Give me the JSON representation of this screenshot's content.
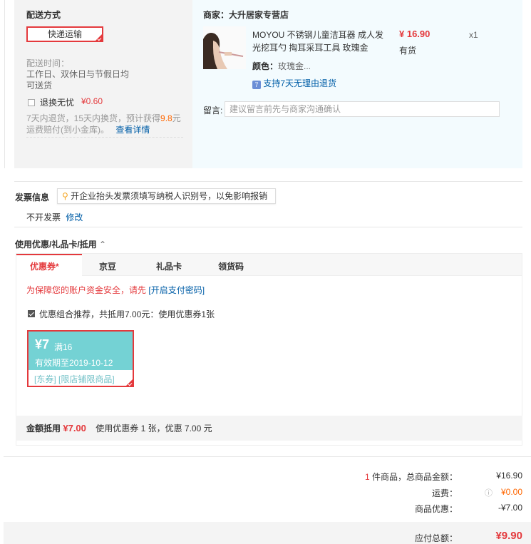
{
  "shipping": {
    "title": "配送方式",
    "method_label": "快递运输",
    "time_label": "配送时间：",
    "time_line1": "工作日、双休日与节假日均",
    "time_line2": "可送货",
    "return_label": "退换无忧",
    "return_price": "¥0.60",
    "return_desc1_a": "7天内退货，15天内换货，预计获得",
    "return_desc1_b": "9.8",
    "return_desc1_c": "元",
    "return_desc2": "运费赔付(到小金库)。",
    "return_detail_link": "查看详情"
  },
  "store": {
    "merchant_label": "商家：大升居家专营店",
    "product_name_line1": "MOYOU 不锈钢儿童洁耳器 成人发",
    "product_name_line2": "光挖耳勺 掏耳采耳工具 玫瑰金",
    "price": "¥ 16.90",
    "stock": "有货",
    "quantity": "x1",
    "color_label": "颜色：",
    "color_value": "玫瑰金...",
    "return_support": "支持7天无理由退货",
    "return_icon_text": "7",
    "message_label": "留言:",
    "message_placeholder": "建议留言前先与商家沟通确认"
  },
  "invoice": {
    "title": "发票信息",
    "tip": "开企业抬头发票须填写纳税人识别号，以免影响报销",
    "status": "不开发票",
    "edit_link": "修改"
  },
  "coupon": {
    "section_title": "使用优惠/礼品卡/抵用",
    "tabs": [
      "优惠券",
      "京豆",
      "礼品卡",
      "领货码"
    ],
    "tab_active_mark": "*",
    "security_warning": "为保障您的账户资金安全，请先",
    "security_link": "[开启支付密码]",
    "recommend_text": "优惠组合推荐，共抵用7.00元：使用优惠券1张",
    "card_amount": "¥7",
    "card_condition": "满16",
    "card_validity": "有效期至2019-10-12",
    "card_tag1": "[东券]",
    "card_tag2": "[限店铺限商品]",
    "summary_label": "金额抵用",
    "summary_amount": "¥7.00",
    "summary_desc": "使用优惠券 1 张，优惠 7.00 元"
  },
  "totals": {
    "item_count": "1",
    "item_count_label": "件商品，总商品金额：",
    "goods_amount": "¥16.90",
    "shipping_label": "运费：",
    "shipping_amount": "¥0.00",
    "discount_label": "商品优惠：",
    "discount_amount": "-¥7.00",
    "payable_label": "应付总额：",
    "payable_amount": "¥9.90"
  },
  "colors": {
    "accent_red": "#e4393c",
    "link_blue": "#005ea7",
    "coupon_teal": "#74d2d4"
  }
}
